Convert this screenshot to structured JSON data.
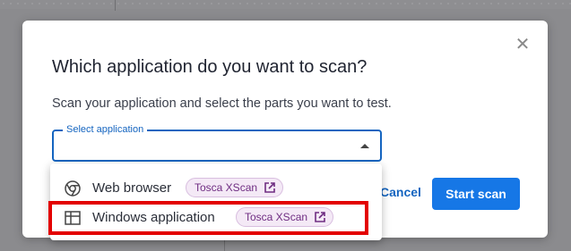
{
  "dialog": {
    "title": "Which application do you want to scan?",
    "subtitle": "Scan your application and select the parts you want to test.",
    "close_icon": "close-icon",
    "select": {
      "label": "Select application",
      "value": "",
      "caret_icon": "caret-up-icon"
    },
    "cancel_label": "Cancel",
    "start_label": "Start scan"
  },
  "dropdown": {
    "options": [
      {
        "label": "Web browser",
        "icon": "chrome-icon",
        "badge": "Tosca XScan",
        "badge_icon": "external-link-icon"
      },
      {
        "label": "Windows application",
        "icon": "windows-icon",
        "badge": "Tosca XScan",
        "badge_icon": "external-link-icon"
      }
    ]
  },
  "colors": {
    "accent": "#1677e6",
    "badge_bg": "#f4e9f6",
    "badge_text": "#6f2d82",
    "highlight": "#e30000"
  }
}
